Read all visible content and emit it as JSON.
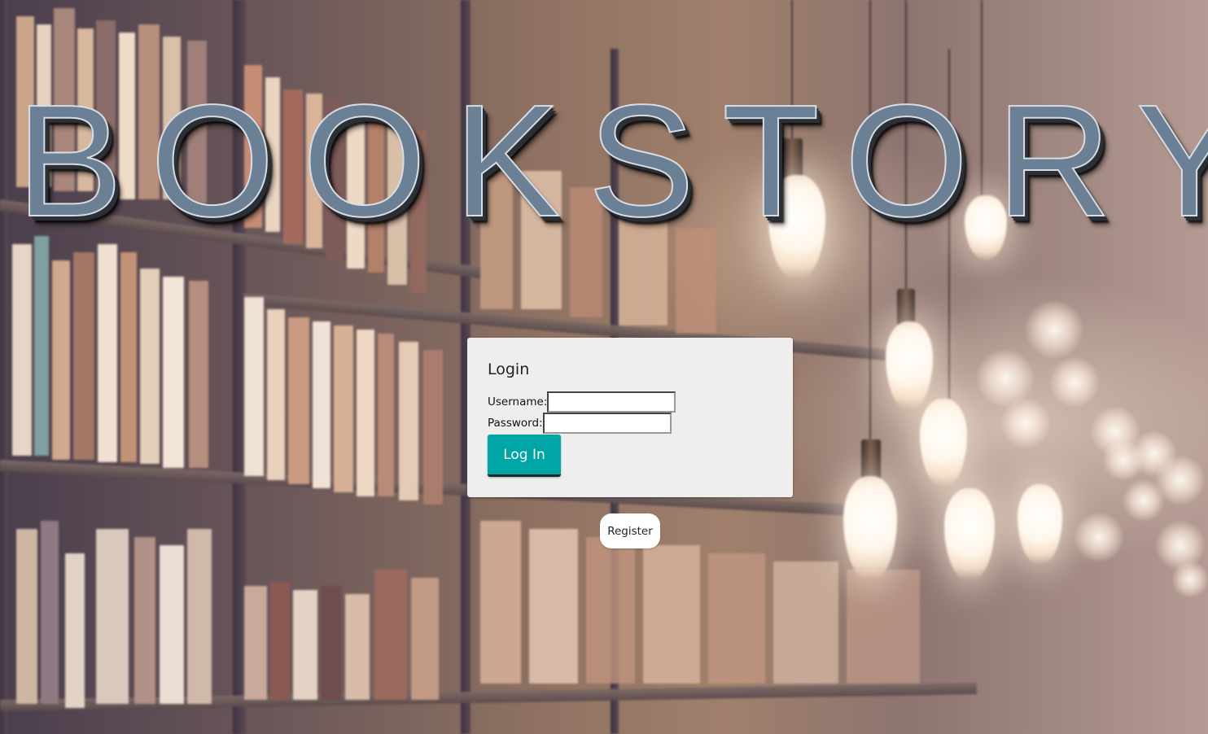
{
  "brand": {
    "title": "BOOKSTORY"
  },
  "login": {
    "heading": "Login",
    "username_label": "Username:",
    "username_value": "",
    "password_label": "Password:",
    "password_value": "",
    "submit_label": "Log In"
  },
  "register": {
    "label": "Register"
  },
  "colors": {
    "brand_text": "#6b7f95",
    "card_background": "#eeeeee",
    "login_button": "#00a6a6",
    "register_button": "#ffffff"
  },
  "background": {
    "description_icon": "library-bookshelf-background"
  }
}
